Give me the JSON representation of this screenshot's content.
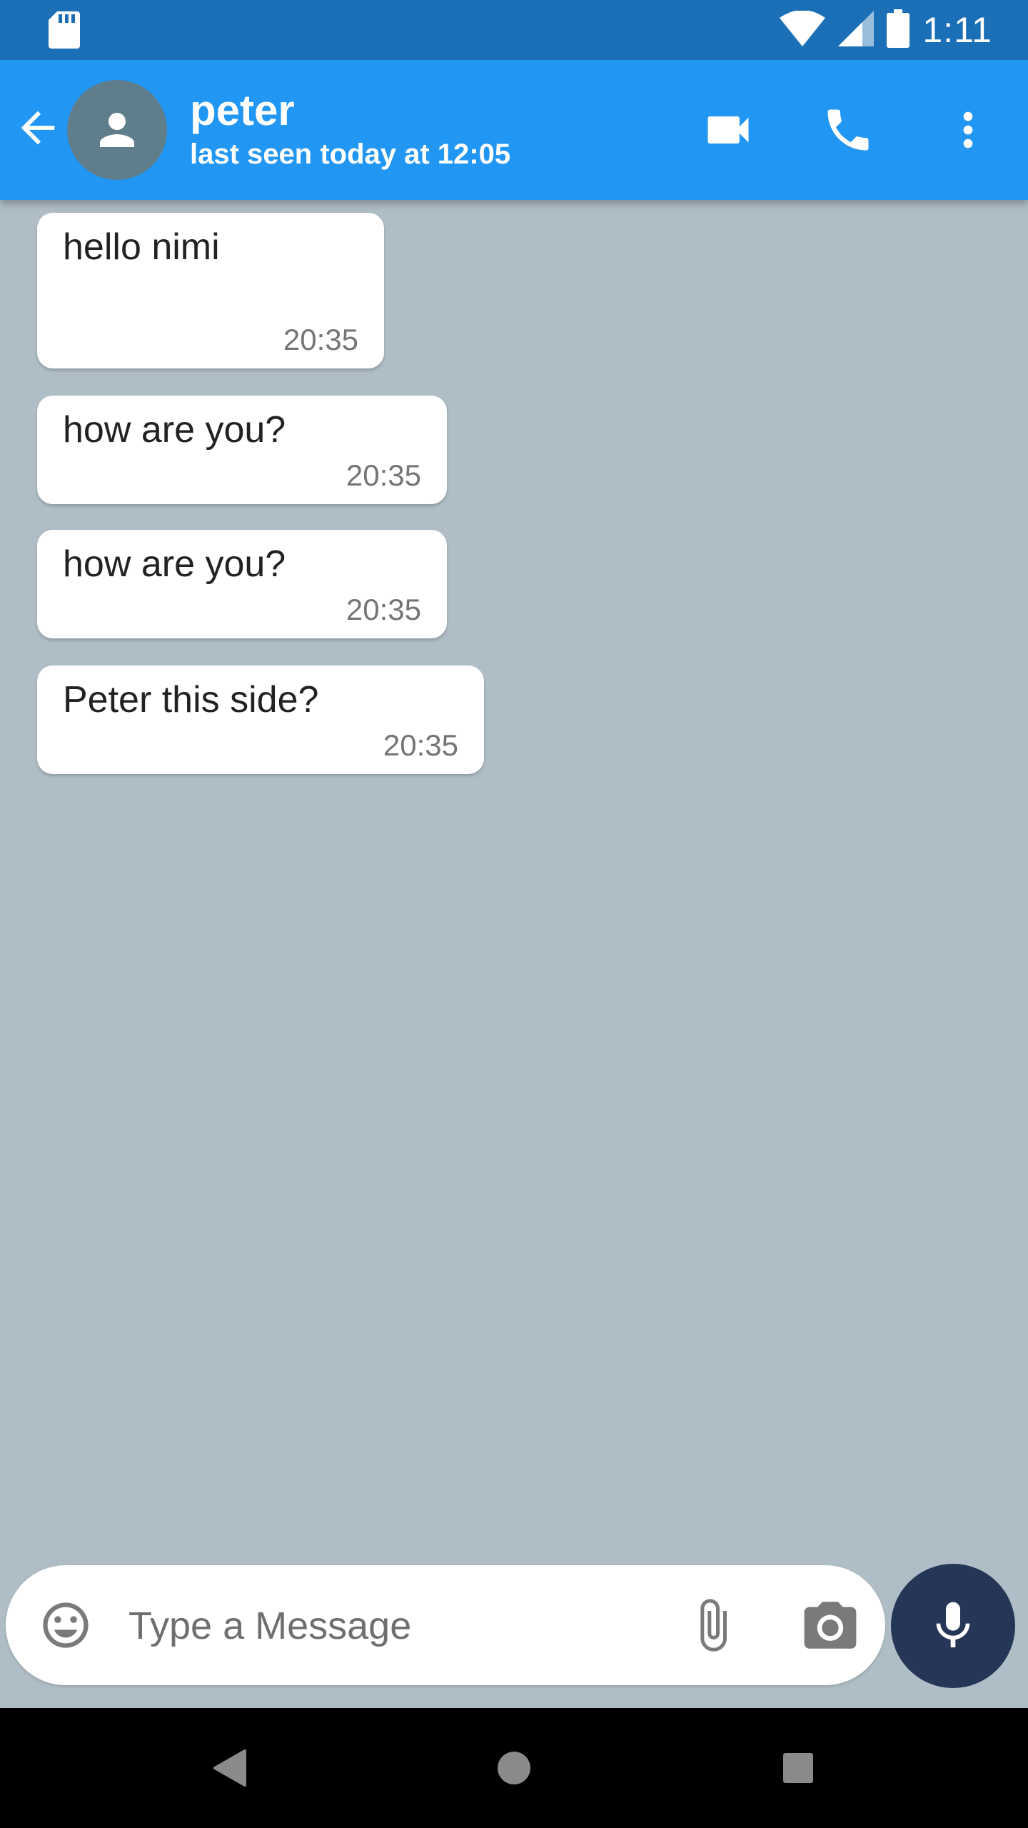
{
  "status_bar": {
    "time": "1:11",
    "icons": [
      "sd-card-icon",
      "wifi-icon",
      "signal-icon",
      "battery-icon"
    ]
  },
  "header": {
    "contact_name": "peter",
    "last_seen": "last seen today at 12:05",
    "actions": [
      "back-arrow-icon",
      "video-call-icon",
      "phone-icon",
      "more-vert-icon"
    ]
  },
  "colors": {
    "status_bar": "#1b6fb7",
    "app_bar": "#2196f3",
    "chat_background": "#afbec6",
    "mic_button": "#263656",
    "avatar": "#607d8b"
  },
  "messages": [
    {
      "text": "hello nimi",
      "time": "20:35"
    },
    {
      "text": "how are you?",
      "time": "20:35"
    },
    {
      "text": "how are you?",
      "time": "20:35"
    },
    {
      "text": "Peter this side?",
      "time": "20:35"
    }
  ],
  "composer": {
    "placeholder": "Type a Message",
    "icons": [
      "emoji-icon",
      "attach-icon",
      "camera-icon",
      "mic-icon"
    ]
  },
  "nav_bar": {
    "icons": [
      "nav-back-icon",
      "nav-home-icon",
      "nav-recents-icon"
    ]
  }
}
